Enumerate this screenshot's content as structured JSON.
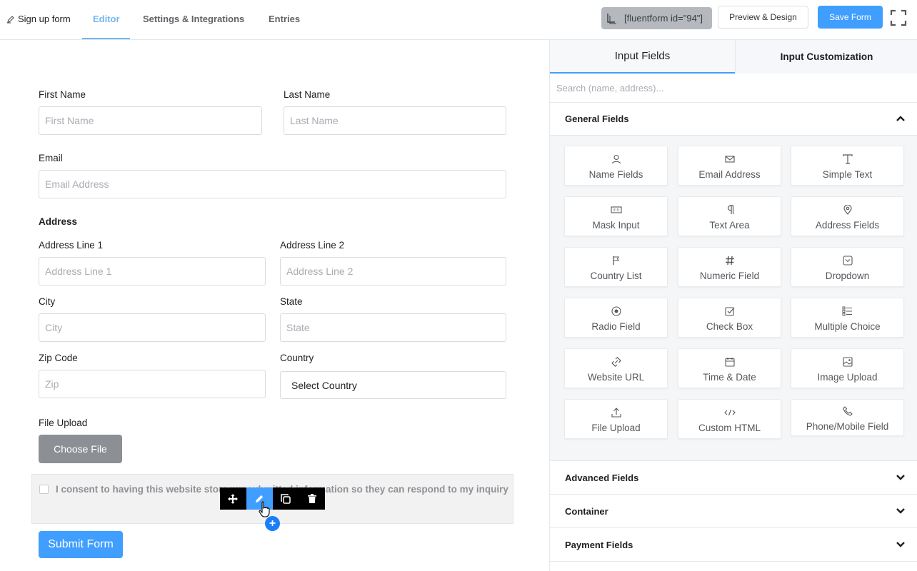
{
  "header": {
    "form_name": "Sign up form",
    "tabs": [
      "Editor",
      "Settings & Integrations",
      "Entries"
    ],
    "shortcode": "[fluentform id=\"94\"]",
    "preview_label": "Preview & Design",
    "save_label": "Save Form"
  },
  "form": {
    "first_name": {
      "label": "First Name",
      "placeholder": "First Name"
    },
    "last_name": {
      "label": "Last Name",
      "placeholder": "Last Name"
    },
    "email": {
      "label": "Email",
      "placeholder": "Email Address"
    },
    "address": {
      "title": "Address",
      "line1": {
        "label": "Address Line 1",
        "placeholder": "Address Line 1"
      },
      "line2": {
        "label": "Address Line 2",
        "placeholder": "Address Line 2"
      },
      "city": {
        "label": "City",
        "placeholder": "City"
      },
      "state": {
        "label": "State",
        "placeholder": "State"
      },
      "zip": {
        "label": "Zip Code",
        "placeholder": "Zip"
      },
      "country": {
        "label": "Country",
        "value": "Select Country"
      }
    },
    "file_upload": {
      "label": "File Upload",
      "button": "Choose File"
    },
    "consent": {
      "text": "I consent to having this website store my submitted information so they can respond to my inquiry"
    },
    "submit_label": "Submit Form",
    "add_label": "+"
  },
  "panel": {
    "tabs": [
      "Input Fields",
      "Input Customization"
    ],
    "search_placeholder": "Search (name, address)...",
    "groups": {
      "general": "General Fields",
      "advanced": "Advanced Fields",
      "container": "Container",
      "payment": "Payment Fields"
    },
    "fields": [
      {
        "label": "Name Fields",
        "icon": "user-icon"
      },
      {
        "label": "Email Address",
        "icon": "envelope-icon"
      },
      {
        "label": "Simple Text",
        "icon": "text-icon"
      },
      {
        "label": "Mask Input",
        "icon": "keyboard-icon"
      },
      {
        "label": "Text Area",
        "icon": "paragraph-icon"
      },
      {
        "label": "Address Fields",
        "icon": "map-pin-icon"
      },
      {
        "label": "Country List",
        "icon": "flag-icon"
      },
      {
        "label": "Numeric Field",
        "icon": "hash-icon"
      },
      {
        "label": "Dropdown",
        "icon": "dropdown-icon"
      },
      {
        "label": "Radio Field",
        "icon": "radio-icon"
      },
      {
        "label": "Check Box",
        "icon": "checkbox-icon"
      },
      {
        "label": "Multiple Choice",
        "icon": "list-icon"
      },
      {
        "label": "Website URL",
        "icon": "link-icon"
      },
      {
        "label": "Time & Date",
        "icon": "calendar-icon"
      },
      {
        "label": "Image Upload",
        "icon": "image-icon"
      },
      {
        "label": "File Upload",
        "icon": "upload-icon"
      },
      {
        "label": "Custom HTML",
        "icon": "code-icon"
      },
      {
        "label": "Phone/Mobile Field",
        "icon": "phone-icon"
      }
    ]
  },
  "colors": {
    "accent": "#409eff",
    "tab_active": "#75b6f0",
    "toolbar": "#000000"
  }
}
